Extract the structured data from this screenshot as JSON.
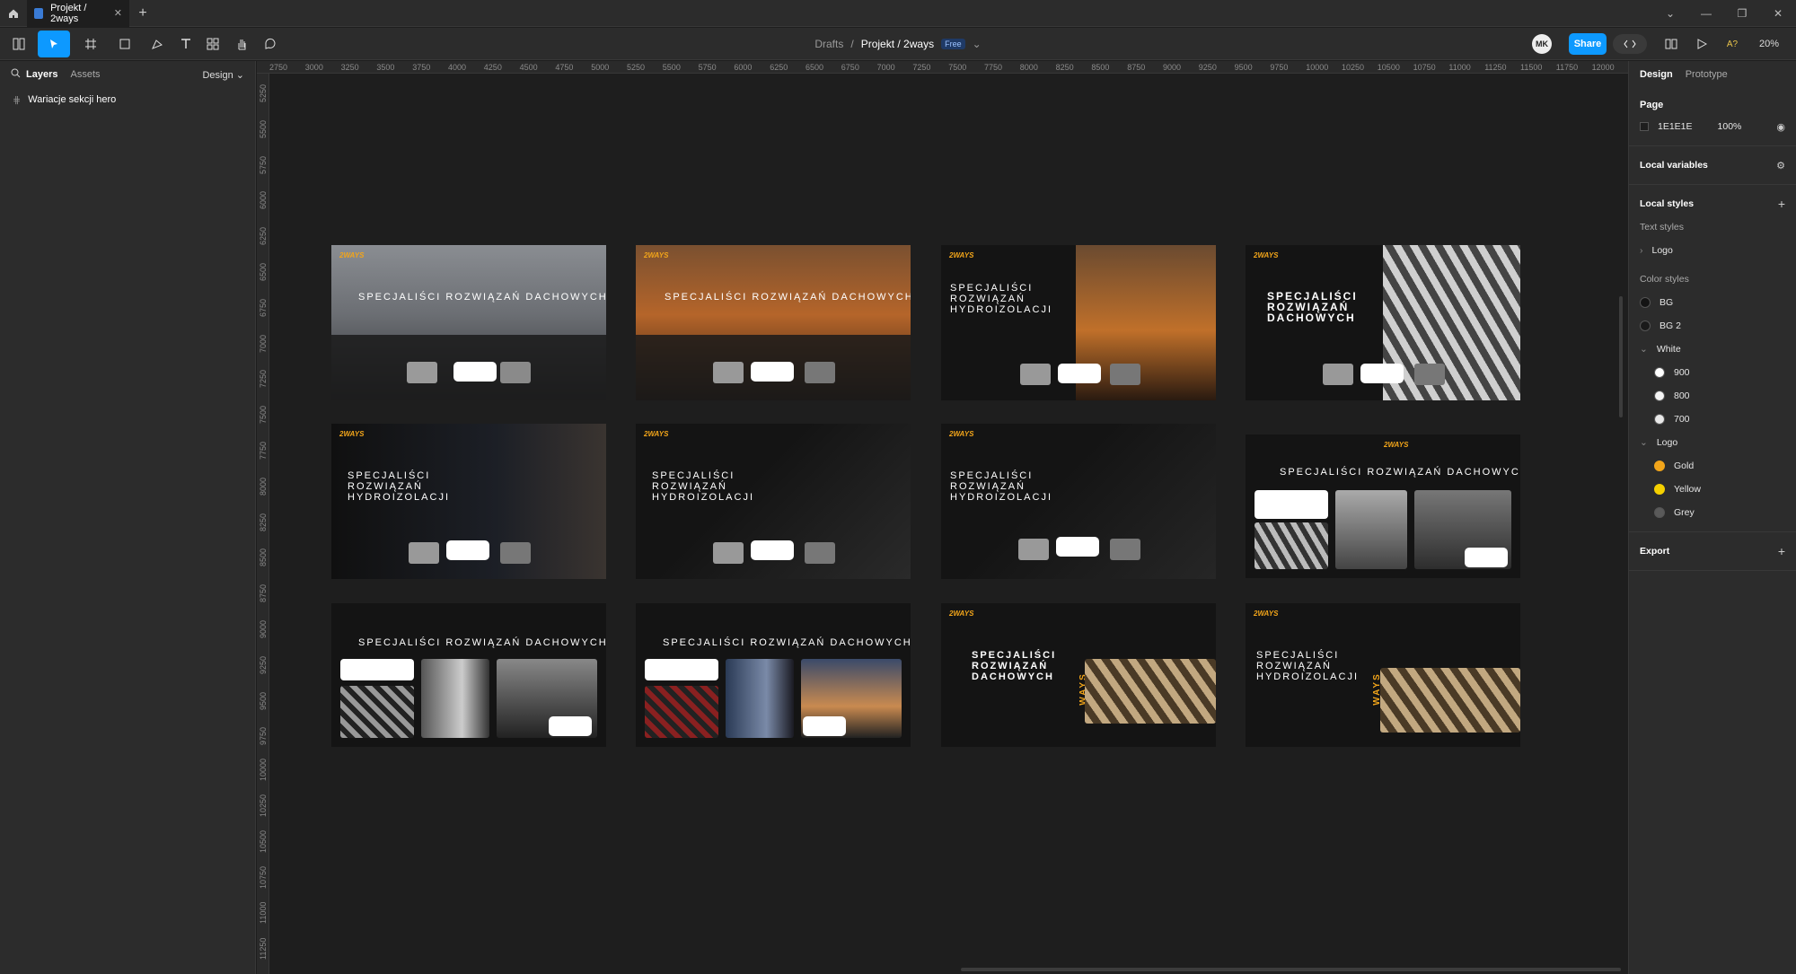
{
  "tab": {
    "title": "Projekt / 2ways"
  },
  "toolbar": {
    "breadcrumb_parent": "Drafts",
    "breadcrumb_sep": "/",
    "file_name": "Projekt / 2ways",
    "plan_badge": "Free",
    "avatar_initials": "MK",
    "share_label": "Share",
    "zoom": "20%"
  },
  "left_panel": {
    "tab_layers": "Layers",
    "tab_assets": "Assets",
    "mode": "Design",
    "layers": [
      {
        "label": "Wariacje sekcji hero"
      }
    ]
  },
  "right_panel": {
    "tab_design": "Design",
    "tab_prototype": "Prototype",
    "page_title": "Page",
    "page_color": "1E1E1E",
    "page_opacity": "100%",
    "local_variables": "Local variables",
    "local_styles": "Local styles",
    "text_styles": "Text styles",
    "text_style_items": [
      "Logo"
    ],
    "color_styles": "Color styles",
    "color_items": [
      {
        "label": "BG",
        "color": "#141414"
      },
      {
        "label": "BG 2",
        "color": "#1a1a1a"
      }
    ],
    "white_group": "White",
    "white_items": [
      {
        "label": "900",
        "color": "#ffffff"
      },
      {
        "label": "800",
        "color": "#f4f4f4"
      },
      {
        "label": "700",
        "color": "#e8e8e8"
      }
    ],
    "logo_group": "Logo",
    "logo_items": [
      {
        "label": "Gold",
        "color": "#f2a51a"
      },
      {
        "label": "Yellow",
        "color": "#f5d000"
      },
      {
        "label": "Grey",
        "color": "#5a5a5a"
      }
    ],
    "export": "Export"
  },
  "ruler_top": [
    "2750",
    "3000",
    "3250",
    "3500",
    "3750",
    "4000",
    "4250",
    "4500",
    "4750",
    "5000",
    "5250",
    "5500",
    "5750",
    "6000",
    "6250",
    "6500",
    "6750",
    "7000",
    "7250",
    "7500",
    "7750",
    "8000",
    "8250",
    "8500",
    "8750",
    "9000",
    "9250",
    "9500",
    "9750",
    "10000",
    "10250",
    "10500",
    "10750",
    "11000",
    "11250",
    "11500",
    "11750",
    "12000"
  ],
  "ruler_left": [
    "5250",
    "5500",
    "5750",
    "6000",
    "6250",
    "6500",
    "6750",
    "7000",
    "7250",
    "7500",
    "7750",
    "8000",
    "8250",
    "8500",
    "8750",
    "9000",
    "9250",
    "9500",
    "9750",
    "10000",
    "10250",
    "10500",
    "10750",
    "11000",
    "11250"
  ],
  "frames": {
    "logo": "2WAYS",
    "h1": "SPECJALIŚCI ROZWIĄZAŃ DACHOWYCH",
    "h2_l1": "SPECJALIŚCI",
    "h2_l2": "ROZWIĄZAŃ",
    "h2_l3": "HYDROIZOLACJI",
    "h3_l3": "DACHOWYCH",
    "ways": "WAYS"
  }
}
